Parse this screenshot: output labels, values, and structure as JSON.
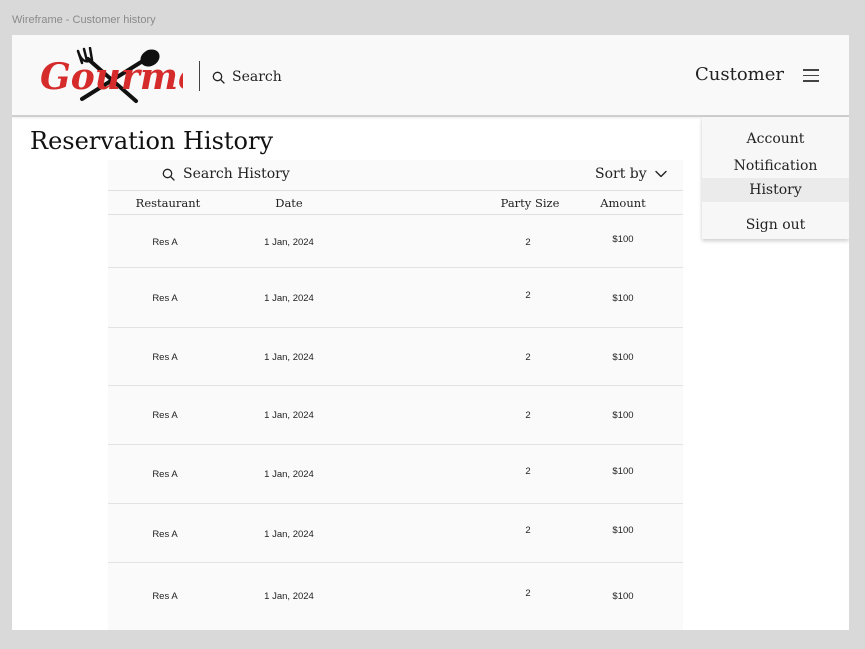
{
  "frame_label": "Wireframe - Customer history",
  "header": {
    "brand": "Gourmet",
    "search_label": "Search",
    "customer_label": "Customer"
  },
  "page_title": "Reservation History",
  "menu": {
    "items": [
      {
        "label": "Account"
      },
      {
        "label": "Notification"
      },
      {
        "label": "History",
        "active": true
      },
      {
        "label": "Sign out"
      }
    ]
  },
  "history": {
    "search_label": "Search History",
    "sort_label": "Sort by",
    "columns": [
      "Restaurant",
      "Date",
      "Party Size",
      "Amount"
    ],
    "rows": [
      {
        "restaurant": "Res A",
        "date": "1 Jan, 2024",
        "party_size": "2",
        "amount": "$100"
      },
      {
        "restaurant": "Res A",
        "date": "1 Jan, 2024",
        "party_size": "2",
        "amount": "$100"
      },
      {
        "restaurant": "Res A",
        "date": "1 Jan, 2024",
        "party_size": "2",
        "amount": "$100"
      },
      {
        "restaurant": "Res A",
        "date": "1 Jan, 2024",
        "party_size": "2",
        "amount": "$100"
      },
      {
        "restaurant": "Res A",
        "date": "1 Jan, 2024",
        "party_size": "2",
        "amount": "$100"
      },
      {
        "restaurant": "Res A",
        "date": "1 Jan, 2024",
        "party_size": "2",
        "amount": "$100"
      },
      {
        "restaurant": "Res A",
        "date": "1 Jan, 2024",
        "party_size": "2",
        "amount": "$100"
      }
    ]
  },
  "colors": {
    "brand_red": "#d52b2b",
    "icon_dark": "#111111"
  }
}
